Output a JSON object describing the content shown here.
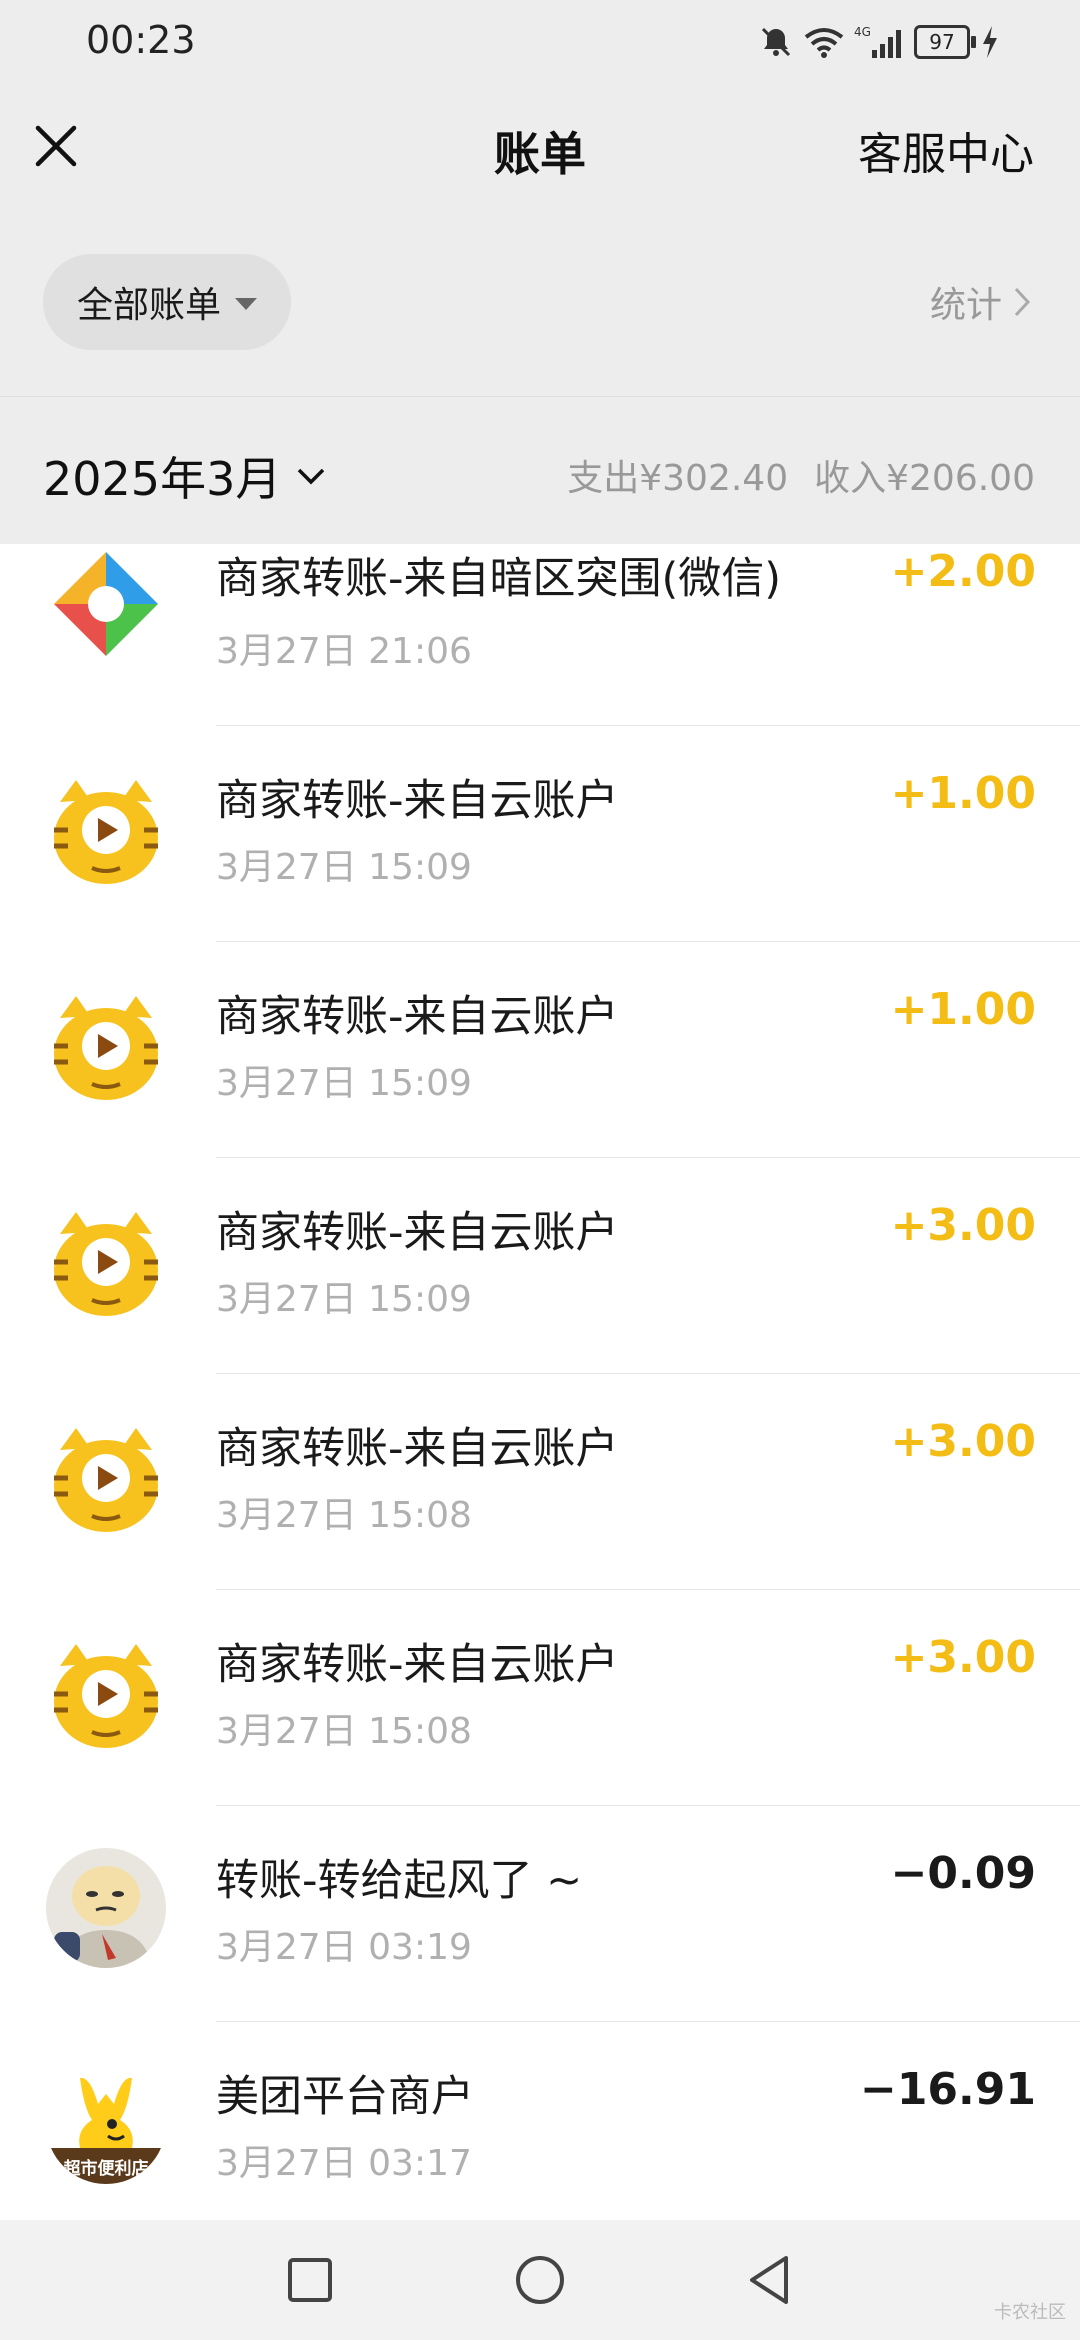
{
  "status_bar": {
    "time": "00:23",
    "battery": "97"
  },
  "header": {
    "title": "账单",
    "service_label": "客服中心"
  },
  "filter": {
    "label": "全部账单",
    "stats_label": "统计"
  },
  "month_bar": {
    "month": "2025年3月",
    "expense": "支出¥302.40",
    "income": "收入¥206.00"
  },
  "transactions": [
    {
      "title": "商家转账-来自暗区突围(微信)",
      "time": "3月27日 21:06",
      "amount": "+2.00",
      "type": "income",
      "avatar": "game-logo"
    },
    {
      "title": "商家转账-来自云账户",
      "time": "3月27日 15:09",
      "amount": "+1.00",
      "type": "income",
      "avatar": "tiger-logo"
    },
    {
      "title": "商家转账-来自云账户",
      "time": "3月27日 15:09",
      "amount": "+1.00",
      "type": "income",
      "avatar": "tiger-logo"
    },
    {
      "title": "商家转账-来自云账户",
      "time": "3月27日 15:09",
      "amount": "+3.00",
      "type": "income",
      "avatar": "tiger-logo"
    },
    {
      "title": "商家转账-来自云账户",
      "time": "3月27日 15:08",
      "amount": "+3.00",
      "type": "income",
      "avatar": "tiger-logo"
    },
    {
      "title": "商家转账-来自云账户",
      "time": "3月27日 15:08",
      "amount": "+3.00",
      "type": "income",
      "avatar": "tiger-logo"
    },
    {
      "title": "转账-转给起风了 ~",
      "time": "3月27日 03:19",
      "amount": "−0.09",
      "type": "expense",
      "avatar": "user-photo"
    },
    {
      "title": "美团平台商户",
      "time": "3月27日 03:17",
      "amount": "−16.91",
      "type": "expense",
      "avatar": "meituan-logo",
      "avatar_text": "超市便利店"
    }
  ],
  "watermark": "卡农社区",
  "colors": {
    "income": "#f3bd16",
    "background": "#ededed",
    "muted": "#999999"
  }
}
